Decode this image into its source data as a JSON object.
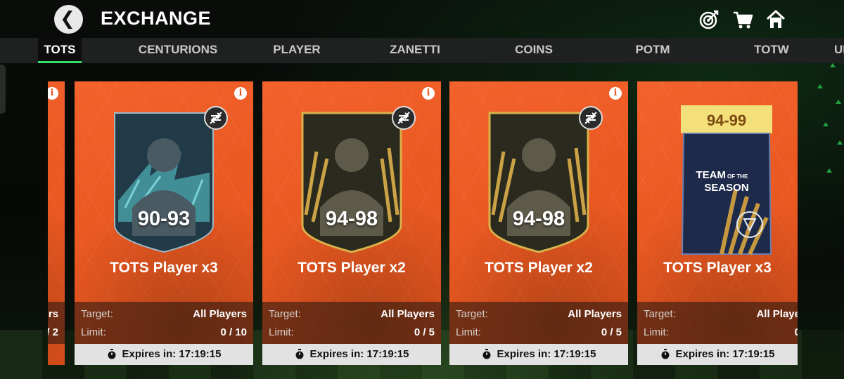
{
  "header": {
    "title": "EXCHANGE",
    "icons": [
      "back-chevron-icon",
      "objectives-target-icon",
      "store-cart-icon",
      "home-icon"
    ]
  },
  "tabs": [
    {
      "label": "TOTS",
      "active": true
    },
    {
      "label": "CENTURIONS"
    },
    {
      "label": "PLAYER"
    },
    {
      "label": "ZANETTI"
    },
    {
      "label": "COINS"
    },
    {
      "label": "POTM"
    },
    {
      "label": "TOTW"
    },
    {
      "label": "UI"
    }
  ],
  "peek_card": {
    "limit_fragment": "/ 2",
    "target_fragment": "rs"
  },
  "cards": [
    {
      "rating": "90-93",
      "name": "TOTS Player x3",
      "target_label": "Target:",
      "target": "All Players",
      "limit_label": "Limit:",
      "limit": "0 / 10",
      "expires": "Expires in: 17:19:15",
      "card_style": "blue"
    },
    {
      "rating": "94-98",
      "name": "TOTS Player x2",
      "target_label": "Target:",
      "target": "All Players",
      "limit_label": "Limit:",
      "limit": "0 / 5",
      "expires": "Expires in: 17:19:15",
      "card_style": "gold"
    },
    {
      "rating": "94-98",
      "name": "TOTS Player x2",
      "target_label": "Target:",
      "target": "All Players",
      "limit_label": "Limit:",
      "limit": "0 / 5",
      "expires": "Expires in: 17:19:15",
      "card_style": "gold"
    },
    {
      "pack_rating": "94-99",
      "pack_title_1": "TEAM",
      "pack_title_2": "OF THE",
      "pack_title_3": "SEASON",
      "name": "TOTS Player x3",
      "target_label": "Target:",
      "target": "All Playe",
      "limit_label": "Limit:",
      "limit": "0",
      "expires": "Expires in: 17:19:15",
      "card_style": "pack"
    }
  ],
  "colors": {
    "card_orange": "#ee5a24",
    "tab_accent": "#33e06a",
    "tab_bar": "#1f2120"
  }
}
